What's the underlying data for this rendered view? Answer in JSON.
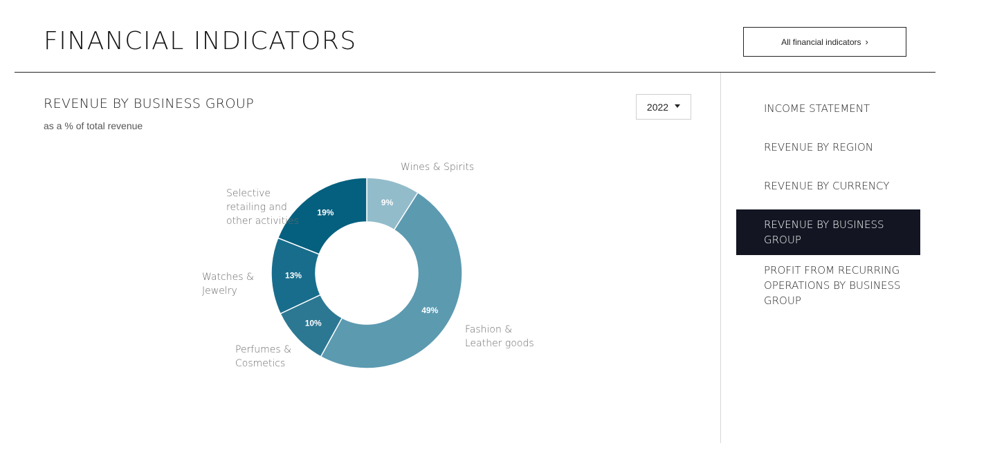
{
  "header": {
    "title": "FINANCIAL INDICATORS",
    "all_button_label": "All financial indicators"
  },
  "section": {
    "title": "REVENUE BY BUSINESS GROUP",
    "subtitle": "as a % of total revenue",
    "year_selected": "2022"
  },
  "side_nav": {
    "items": [
      {
        "label": "INCOME STATEMENT",
        "active": false
      },
      {
        "label": "REVENUE BY REGION",
        "active": false
      },
      {
        "label": "REVENUE BY CURRENCY",
        "active": false
      },
      {
        "label": "REVENUE BY BUSINESS GROUP",
        "active": true
      },
      {
        "label": "PROFIT FROM RECURRING OPERATIONS BY BUSINESS GROUP",
        "active": false
      }
    ]
  },
  "chart_data": {
    "type": "pie",
    "donut": true,
    "unit": "%",
    "slices": [
      {
        "label": "Wines & Spirits",
        "value": 9,
        "display": "9%",
        "color": "#93bccb"
      },
      {
        "label": "Fashion & Leather goods",
        "value": 49,
        "display": "49%",
        "color": "#5c9ab0"
      },
      {
        "label": "Perfumes & Cosmetics",
        "value": 10,
        "display": "10%",
        "color": "#2c7893"
      },
      {
        "label": "Watches & Jewelry",
        "value": 13,
        "display": "13%",
        "color": "#196d8c"
      },
      {
        "label": "Selective retailing and other activities",
        "value": 19,
        "display": "19%",
        "color": "#05607f"
      }
    ],
    "legend": "none",
    "label_placement": "outside"
  }
}
